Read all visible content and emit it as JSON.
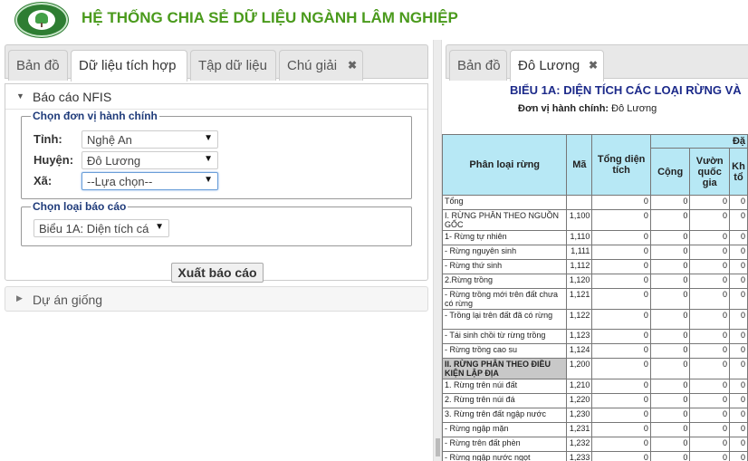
{
  "header": {
    "title": "HỆ THỐNG CHIA SẺ DỮ LIỆU NGÀNH LÂM NGHIỆP"
  },
  "left_tabs": [
    "Bản đồ",
    "Dữ liệu tích hợp",
    "Tập dữ liệu",
    "Chú giải"
  ],
  "right_tabs": [
    "Bản đồ",
    "Đô Lương"
  ],
  "nfis": {
    "title": "Báo cáo NFIS",
    "unit_group": "Chọn đơn vị hành chính",
    "province_label": "Tỉnh:",
    "province_value": "Nghệ An",
    "district_label": "Huyện:",
    "district_value": "Đô Lương",
    "commune_label": "Xã:",
    "commune_value": "--Lựa chọn--",
    "report_group": "Chọn loại báo cáo",
    "report_value": "Biểu 1A: Diện tích cá",
    "export_label": "Xuất báo cáo"
  },
  "seed": {
    "title": "Dự án giống"
  },
  "report": {
    "title": "BIỂU 1A: DIỆN TÍCH CÁC LOẠI RỪNG VÀ",
    "unit_label": "Đơn vị hành chính:",
    "unit_value": " Đô Lương",
    "headers": {
      "category": "Phân loại rừng",
      "code": "Mã",
      "total": "Tổng diện tích",
      "group": "Đặ",
      "sum": "Cộng",
      "park": "Vườn quốc gia",
      "reserve": "Kh tổ"
    },
    "rows": [
      {
        "name": "Tổng",
        "code": "",
        "values": [
          "0",
          "0",
          "0",
          "0"
        ]
      },
      {
        "name": "I. RỪNG PHÂN THEO NGUỒN GỐC",
        "code": "1,100",
        "values": [
          "0",
          "0",
          "0",
          "0"
        ]
      },
      {
        "name": "1- Rừng tự nhiên",
        "code": "1,110",
        "values": [
          "0",
          "0",
          "0",
          "0"
        ]
      },
      {
        "name": "- Rừng nguyên sinh",
        "code": "1,111",
        "values": [
          "0",
          "0",
          "0",
          "0"
        ]
      },
      {
        "name": "- Rừng thứ sinh",
        "code": "1,112",
        "values": [
          "0",
          "0",
          "0",
          "0"
        ]
      },
      {
        "name": "2.Rừng trồng",
        "code": "1,120",
        "values": [
          "0",
          "0",
          "0",
          "0"
        ]
      },
      {
        "name": "- Rừng trồng mới trên đất chưa có rừng",
        "code": "1,121",
        "values": [
          "0",
          "0",
          "0",
          "0"
        ]
      },
      {
        "name": "- Trồng lại trên đất đã có rừng",
        "code": "1,122",
        "values": [
          "0",
          "0",
          "0",
          "0"
        ]
      },
      {
        "name": "- Tái sinh chồi từ rừng trồng",
        "code": "1,123",
        "values": [
          "0",
          "0",
          "0",
          "0"
        ]
      },
      {
        "name": "- Rừng trồng cao su",
        "code": "1,124",
        "values": [
          "0",
          "0",
          "0",
          "0"
        ]
      },
      {
        "name": "II. RỪNG PHÂN THEO ĐIỀU KIỆN LẬP ĐỊA",
        "code": "1,200",
        "values": [
          "0",
          "0",
          "0",
          "0"
        ],
        "highlight": true
      },
      {
        "name": "1. Rừng trên núi đất",
        "code": "1,210",
        "values": [
          "0",
          "0",
          "0",
          "0"
        ]
      },
      {
        "name": "2. Rừng trên núi đá",
        "code": "1,220",
        "values": [
          "0",
          "0",
          "0",
          "0"
        ]
      },
      {
        "name": "3. Rừng trên đất ngập nước",
        "code": "1,230",
        "values": [
          "0",
          "0",
          "0",
          "0"
        ]
      },
      {
        "name": "- Rừng ngập mặn",
        "code": "1,231",
        "values": [
          "0",
          "0",
          "0",
          "0"
        ]
      },
      {
        "name": "- Rừng trên đất phèn",
        "code": "1,232",
        "values": [
          "0",
          "0",
          "0",
          "0"
        ]
      },
      {
        "name": "- Rừng ngập nước ngọt",
        "code": "1,233",
        "values": [
          "0",
          "0",
          "0",
          "0"
        ]
      }
    ]
  }
}
